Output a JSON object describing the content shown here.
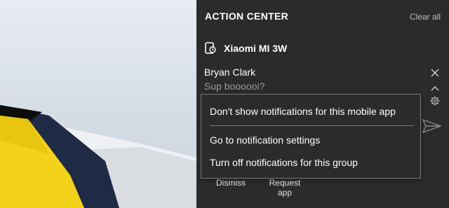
{
  "action_center": {
    "title": "ACTION CENTER",
    "clear_all": "Clear all"
  },
  "notification_group": {
    "app_icon": "phone-icon",
    "app_name": "Xiaomi MI 3W"
  },
  "notification": {
    "sender": "Bryan Clark",
    "message": "Sup boooooi?",
    "actions": {
      "dismiss": "Dismiss",
      "request_app_line1": "Request",
      "request_app_line2": "app"
    }
  },
  "context_menu": {
    "items": [
      "Don't show notifications for this mobile app",
      "Go to notification settings",
      "Turn off notifications for this group"
    ]
  },
  "colors": {
    "panel_bg": "#2b2b2b",
    "menu_border": "#7a7a7a",
    "secondary_text": "#9b9b9b",
    "wallpaper_yellow": "#f3d21c",
    "wallpaper_navy": "#1f2a44"
  }
}
